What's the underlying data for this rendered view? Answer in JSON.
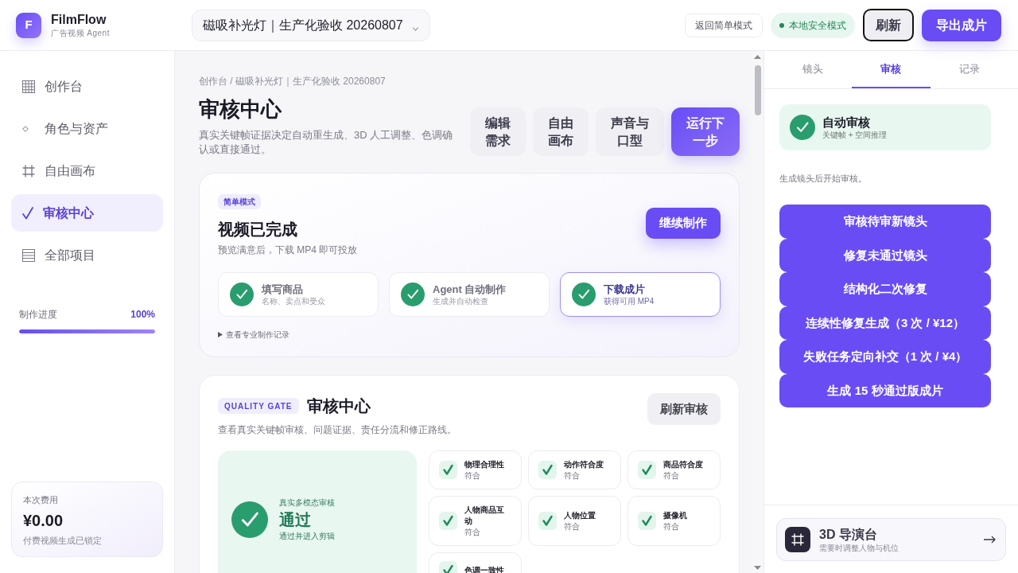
{
  "header": {
    "logo": {
      "letter": "F",
      "name": "FilmFlow",
      "tagline": "广告视频 Agent"
    },
    "project": {
      "value": "磁吸补光灯｜生产化验收 20260807"
    },
    "actions": [
      {
        "kind": "outline",
        "label": "返回简单模式",
        "focused": false
      },
      {
        "kind": "status",
        "label": "本地安全模式",
        "focused": false
      },
      {
        "kind": "secondary",
        "label": "刷新",
        "focused": true
      },
      {
        "kind": "primary",
        "label": "导出成片",
        "focused": false
      }
    ]
  },
  "sidebar": {
    "items": [
      {
        "label": "创作台",
        "selected": false
      },
      {
        "label": "角色与资产",
        "selected": false
      },
      {
        "label": "自由画布",
        "selected": false
      },
      {
        "label": "审核中心",
        "selected": true
      },
      {
        "label": "全部项目",
        "selected": false
      }
    ],
    "progress": {
      "label": "制作进度",
      "reading": "100%",
      "level": 1
    },
    "cost": {
      "label": "本次费用",
      "amount": "¥0.00",
      "note": "付费视频生成已锁定"
    }
  },
  "page": {
    "breadcrumb": "创作台 / 磁吸补光灯｜生产化验收 20260807",
    "title": "审核中心",
    "description": "真实关键帧证据决定自动重生成、3D 人工调整、色调确认或直接通过。",
    "actions": [
      {
        "kind": "secondary",
        "label": "编辑需求"
      },
      {
        "kind": "secondary",
        "label": "自由画布"
      },
      {
        "kind": "secondary",
        "label": "声音与口型"
      },
      {
        "kind": "primary",
        "label": "运行下一步"
      }
    ]
  },
  "simple_mode": {
    "badge": "简单模式",
    "title": "视频已完成",
    "subtitle": "预览满意后，下载 MP4 即可投放",
    "button": "继续制作",
    "steps": [
      {
        "title": "填写商品",
        "subtitle": "名称、卖点和受众",
        "done": true,
        "selected": false
      },
      {
        "title": "Agent 自动制作",
        "subtitle": "生成并自动检查",
        "done": true,
        "selected": false
      },
      {
        "title": "下载成片",
        "subtitle": "获得可用 MP4",
        "done": true,
        "selected": true
      }
    ],
    "history": {
      "label": "查看专业制作记录",
      "expanded": false
    }
  },
  "quality_gate": {
    "badge": "QUALITY GATE",
    "title": "审核中心",
    "description": "查看真实关键帧审核、问题证据、责任分流和修正路线。",
    "button": "刷新审核",
    "verdict": {
      "kicker": "真实多模态审核",
      "result": "通过",
      "note": "通过并进入剪辑"
    },
    "checks": [
      {
        "name": "物理合理性",
        "result": "符合",
        "passed": true
      },
      {
        "name": "动作符合度",
        "result": "符合",
        "passed": true
      },
      {
        "name": "商品符合度",
        "result": "符合",
        "passed": true
      },
      {
        "name": "人物商品互动",
        "result": "符合",
        "passed": true
      },
      {
        "name": "人物位置",
        "result": "符合",
        "passed": true
      },
      {
        "name": "摄像机",
        "result": "符合",
        "passed": true
      },
      {
        "name": "色调一致性",
        "passed": true
      }
    ]
  },
  "review_panel": {
    "tabs": [
      {
        "label": "镜头",
        "selected": false
      },
      {
        "label": "审核",
        "selected": true
      },
      {
        "label": "记录",
        "selected": false
      }
    ],
    "auto_review": {
      "title": "自动审核",
      "subtitle": "关键帧 + 空间推理"
    },
    "note": "生成镜头后开始审核。",
    "actions": [
      "审核待审新镜头",
      "修复未通过镜头",
      "结构化二次修复",
      "连续性修复生成（3 次 / ¥12）",
      "失败任务定向补交（1 次 / ¥4）",
      "生成 15 秒通过版成片"
    ],
    "director": {
      "title": "3D 导演台",
      "subtitle": "需要时调整人物与机位"
    }
  }
}
